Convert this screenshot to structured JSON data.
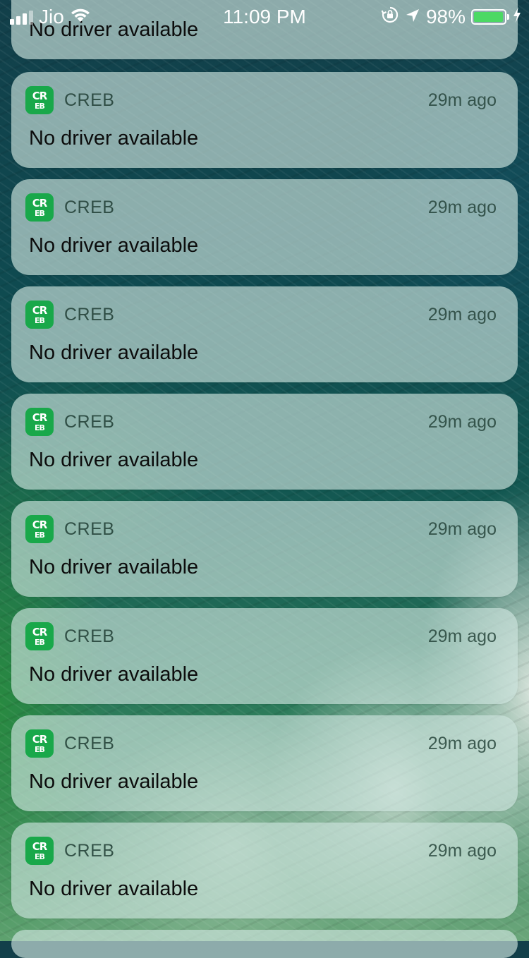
{
  "status_bar": {
    "carrier": "Jio",
    "time": "11:09 PM",
    "battery_percent": "98%",
    "battery_level": 0.98,
    "icons": [
      "signal-icon",
      "wifi-icon",
      "orientation-lock-icon",
      "location-icon",
      "battery-icon",
      "charging-icon"
    ]
  },
  "notifications": [
    {
      "app": "CREB",
      "time": "29m ago",
      "message": "No driver available"
    },
    {
      "app": "CREB",
      "time": "29m ago",
      "message": "No driver available"
    },
    {
      "app": "CREB",
      "time": "29m ago",
      "message": "No driver available"
    },
    {
      "app": "CREB",
      "time": "29m ago",
      "message": "No driver available"
    },
    {
      "app": "CREB",
      "time": "29m ago",
      "message": "No driver available"
    },
    {
      "app": "CREB",
      "time": "29m ago",
      "message": "No driver available"
    },
    {
      "app": "CREB",
      "time": "29m ago",
      "message": "No driver available"
    },
    {
      "app": "CREB",
      "time": "29m ago",
      "message": "No driver available"
    }
  ],
  "partial_top_message": "No driver available",
  "app_icon": {
    "line1": "CR",
    "line2": "EB",
    "color": "#19a84a"
  },
  "colors": {
    "battery_fill": "#4cd964",
    "app_icon": "#19a84a"
  }
}
